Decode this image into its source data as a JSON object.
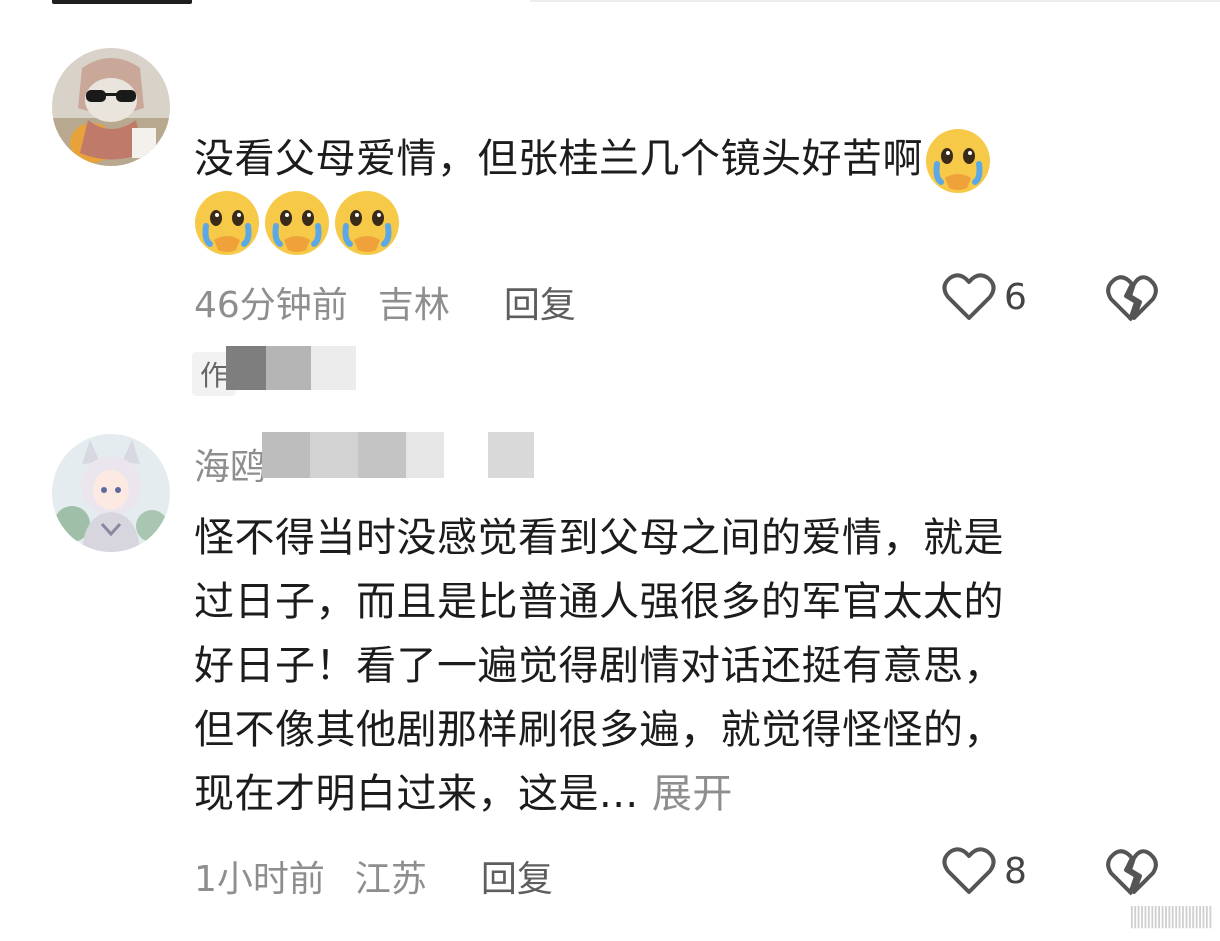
{
  "comments": [
    {
      "text_line1": "没看父母爱情，但张桂兰几个镜头好苦啊",
      "emoji": "crying-face-emoji",
      "time": "46分钟前",
      "location": "吉林",
      "reply_label": "回复",
      "likes": "6"
    },
    {
      "author_tag": "作",
      "username": "海鸥",
      "lines": [
        "怪不得当时没感觉看到父母之间的爱情，就是",
        "过日子，而且是比普通人强很多的军官太太的",
        "好日子！看了一遍觉得剧情对话还挺有意思，",
        "但不像其他剧那样刷很多遍，就觉得怪怪的，",
        "现在才明白过来，这是..."
      ],
      "expand_label": "展开",
      "time": "1小时前",
      "location": "江苏",
      "reply_label": "回复",
      "likes": "8"
    }
  ],
  "colors": {
    "meta_gray": "#8e8e8e",
    "text": "#1c1c1c",
    "emoji_yellow": "#f7c948"
  }
}
